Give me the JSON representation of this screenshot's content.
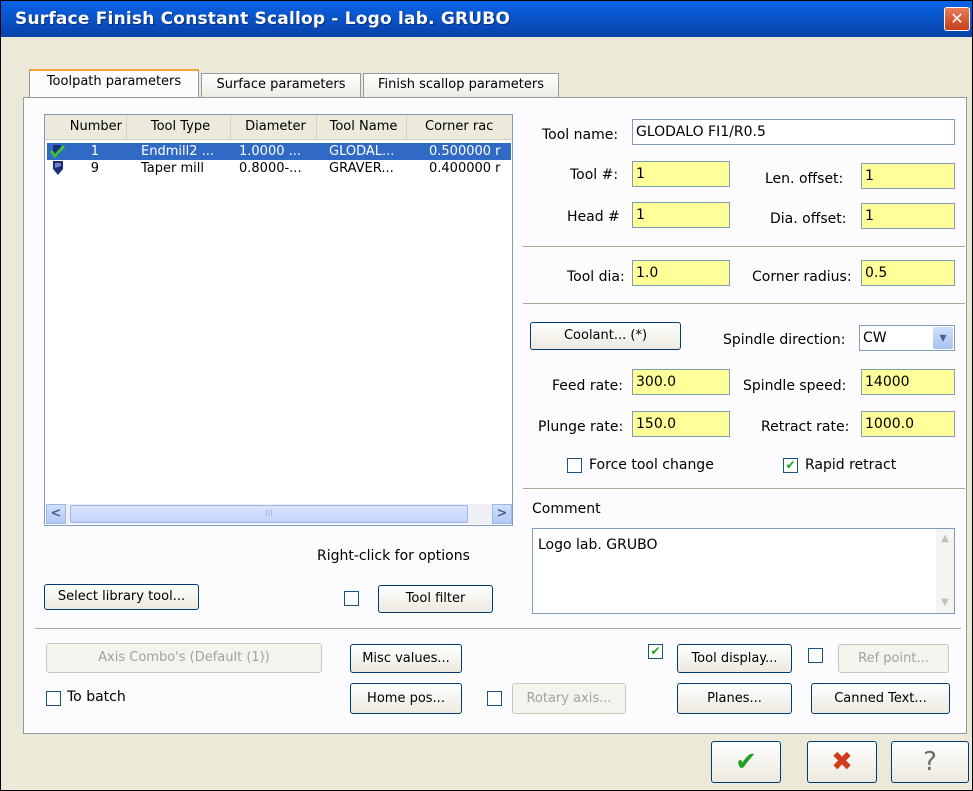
{
  "window": {
    "title": "Surface Finish Constant Scallop - Logo lab. GRUBO",
    "close_glyph": "✕"
  },
  "tabs": [
    {
      "label": "Toolpath parameters"
    },
    {
      "label": "Surface parameters"
    },
    {
      "label": "Finish scallop parameters"
    }
  ],
  "tool_list": {
    "columns": [
      "Number",
      "Tool Type",
      "Diameter",
      "Tool Name",
      "Corner rac"
    ],
    "rows": [
      {
        "number": "1",
        "type": "Endmill2 ...",
        "diameter": "1.0000 ...",
        "name": "GLODAL...",
        "corner": "0.500000 r",
        "icon": "endmill-check-icon"
      },
      {
        "number": "9",
        "type": "Taper mill",
        "diameter": "0.8000-...",
        "name": "GRAVER...",
        "corner": "0.400000 r",
        "icon": "tool-icon"
      }
    ],
    "scroll_left": "<",
    "scroll_right": ">",
    "scroll_grip": "III"
  },
  "right_click_hint": "Right-click for options",
  "buttons": {
    "select_library_tool": "Select library tool...",
    "tool_filter": "Tool filter",
    "coolant": "Coolant... (*)",
    "axis_combo": "Axis Combo's (Default (1))",
    "misc_values": "Misc values...",
    "home_pos": "Home pos...",
    "rotary_axis": "Rotary axis...",
    "tool_display": "Tool display...",
    "ref_point": "Ref point...",
    "planes": "Planes...",
    "canned_text": "Canned Text...",
    "ok_glyph": "✔",
    "cancel_glyph": "✖",
    "help_glyph": "?"
  },
  "fields": {
    "tool_name_label": "Tool name:",
    "tool_name": "GLODALO FI1/R0.5",
    "tool_num_label": "Tool #:",
    "tool_num": "1",
    "len_offset_label": "Len. offset:",
    "len_offset": "1",
    "head_num_label": "Head #",
    "head_num": "1",
    "dia_offset_label": "Dia. offset:",
    "dia_offset": "1",
    "tool_dia_label": "Tool dia:",
    "tool_dia": "1.0",
    "corner_radius_label": "Corner radius:",
    "corner_radius": "0.5",
    "spindle_direction_label": "Spindle direction:",
    "spindle_direction": "CW",
    "feed_rate_label": "Feed rate:",
    "feed_rate": "300.0",
    "spindle_speed_label": "Spindle speed:",
    "spindle_speed": "14000",
    "plunge_rate_label": "Plunge rate:",
    "plunge_rate": "150.0",
    "retract_rate_label": "Retract rate:",
    "retract_rate": "1000.0",
    "comment_label": "Comment",
    "comment": "Logo lab. GRUBO"
  },
  "checkboxes": {
    "force_tool_change": {
      "label": "Force tool change",
      "checked": false
    },
    "rapid_retract": {
      "label": "Rapid retract",
      "checked": true
    },
    "tool_filter": {
      "checked": false
    },
    "to_batch": {
      "label": "To batch",
      "checked": false
    },
    "rotary_axis": {
      "checked": false
    },
    "tool_display": {
      "checked": true
    },
    "ref_point": {
      "checked": false
    }
  },
  "check_glyph": "✔",
  "dropdown_glyph": "▾",
  "colors": {
    "title_bar": "#0a63e6",
    "input_highlight": "#ffff99",
    "selection": "#316ac5",
    "ok_green": "#21a121",
    "cancel_red": "#d23c1a"
  }
}
